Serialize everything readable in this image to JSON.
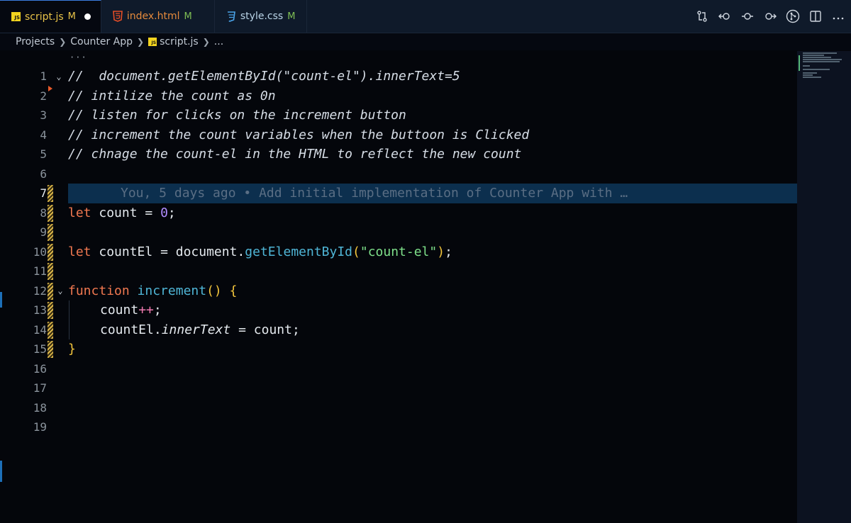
{
  "tabs": [
    {
      "label": "script.js",
      "status": "M",
      "type": "js",
      "active": true,
      "dirty": true
    },
    {
      "label": "index.html",
      "status": "M",
      "type": "html",
      "active": false,
      "dirty": false
    },
    {
      "label": "style.css",
      "status": "M",
      "type": "css",
      "active": false,
      "dirty": false
    }
  ],
  "js_badge": "JS",
  "breadcrumb": {
    "items": [
      "Projects",
      "Counter App",
      "script.js",
      "..."
    ]
  },
  "fold_dots": "···",
  "lines": [
    {
      "n": "1"
    },
    {
      "n": "2"
    },
    {
      "n": "3"
    },
    {
      "n": "4"
    },
    {
      "n": "5"
    },
    {
      "n": "6"
    },
    {
      "n": "7"
    },
    {
      "n": "8"
    },
    {
      "n": "9"
    },
    {
      "n": "10"
    },
    {
      "n": "11"
    },
    {
      "n": "12"
    },
    {
      "n": "13"
    },
    {
      "n": "14"
    },
    {
      "n": "15"
    },
    {
      "n": "16"
    },
    {
      "n": "17"
    },
    {
      "n": "18"
    },
    {
      "n": "19"
    }
  ],
  "code": {
    "l1": "//  document.getElementById(\"count-el\").innerText=5",
    "l2": "// intilize the count as 0n",
    "l3": "// listen for clicks on the increment button",
    "l4": "// increment the count variables when the buttoon is Clicked",
    "l5": "// chnage the count-el in the HTML to reflect the new count",
    "blame": "You, 5 days ago • Add initial implementation of Counter App with …",
    "l8": {
      "kw": "let",
      "name": "count",
      "op": "=",
      "num": "0",
      "end": ";"
    },
    "l10": {
      "kw": "let",
      "name": "countEl",
      "op": "=",
      "obj": "document.",
      "fn": "getElementById",
      "open": "(",
      "str": "\"count-el\"",
      "close": ")",
      "end": ";"
    },
    "l12": {
      "kw": "function",
      "fn": "increment",
      "parens": "()",
      "brace": "{"
    },
    "l13": {
      "name": "count",
      "inc": "++",
      "end": ";"
    },
    "l14": {
      "obj": "countEl.",
      "prop": "innerText",
      "op": "=",
      "val": "count",
      "end": ";"
    },
    "l15": {
      "brace": "}"
    }
  },
  "colors": {
    "accent": "#3b7de0",
    "js_badge": "#f2d31f",
    "keyword": "#f07850",
    "function": "#4fb5d6",
    "string": "#7ee08a",
    "number": "#b08cff",
    "blame_bg": "#0c2f4e"
  }
}
